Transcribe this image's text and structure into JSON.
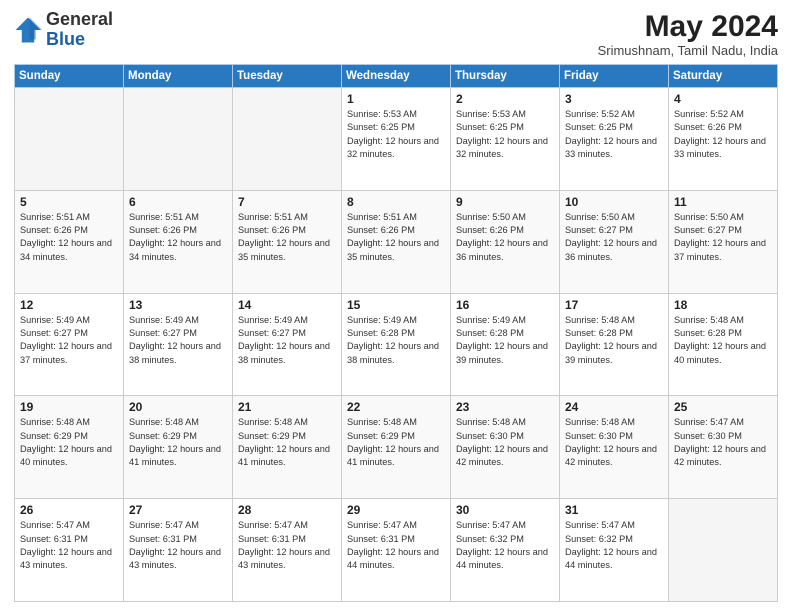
{
  "header": {
    "logo_general": "General",
    "logo_blue": "Blue",
    "month_year": "May 2024",
    "location": "Srimushnam, Tamil Nadu, India"
  },
  "days_of_week": [
    "Sunday",
    "Monday",
    "Tuesday",
    "Wednesday",
    "Thursday",
    "Friday",
    "Saturday"
  ],
  "weeks": [
    [
      {
        "day": "",
        "info": ""
      },
      {
        "day": "",
        "info": ""
      },
      {
        "day": "",
        "info": ""
      },
      {
        "day": "1",
        "info": "Sunrise: 5:53 AM\nSunset: 6:25 PM\nDaylight: 12 hours\nand 32 minutes."
      },
      {
        "day": "2",
        "info": "Sunrise: 5:53 AM\nSunset: 6:25 PM\nDaylight: 12 hours\nand 32 minutes."
      },
      {
        "day": "3",
        "info": "Sunrise: 5:52 AM\nSunset: 6:25 PM\nDaylight: 12 hours\nand 33 minutes."
      },
      {
        "day": "4",
        "info": "Sunrise: 5:52 AM\nSunset: 6:26 PM\nDaylight: 12 hours\nand 33 minutes."
      }
    ],
    [
      {
        "day": "5",
        "info": "Sunrise: 5:51 AM\nSunset: 6:26 PM\nDaylight: 12 hours\nand 34 minutes."
      },
      {
        "day": "6",
        "info": "Sunrise: 5:51 AM\nSunset: 6:26 PM\nDaylight: 12 hours\nand 34 minutes."
      },
      {
        "day": "7",
        "info": "Sunrise: 5:51 AM\nSunset: 6:26 PM\nDaylight: 12 hours\nand 35 minutes."
      },
      {
        "day": "8",
        "info": "Sunrise: 5:51 AM\nSunset: 6:26 PM\nDaylight: 12 hours\nand 35 minutes."
      },
      {
        "day": "9",
        "info": "Sunrise: 5:50 AM\nSunset: 6:26 PM\nDaylight: 12 hours\nand 36 minutes."
      },
      {
        "day": "10",
        "info": "Sunrise: 5:50 AM\nSunset: 6:27 PM\nDaylight: 12 hours\nand 36 minutes."
      },
      {
        "day": "11",
        "info": "Sunrise: 5:50 AM\nSunset: 6:27 PM\nDaylight: 12 hours\nand 37 minutes."
      }
    ],
    [
      {
        "day": "12",
        "info": "Sunrise: 5:49 AM\nSunset: 6:27 PM\nDaylight: 12 hours\nand 37 minutes."
      },
      {
        "day": "13",
        "info": "Sunrise: 5:49 AM\nSunset: 6:27 PM\nDaylight: 12 hours\nand 38 minutes."
      },
      {
        "day": "14",
        "info": "Sunrise: 5:49 AM\nSunset: 6:27 PM\nDaylight: 12 hours\nand 38 minutes."
      },
      {
        "day": "15",
        "info": "Sunrise: 5:49 AM\nSunset: 6:28 PM\nDaylight: 12 hours\nand 38 minutes."
      },
      {
        "day": "16",
        "info": "Sunrise: 5:49 AM\nSunset: 6:28 PM\nDaylight: 12 hours\nand 39 minutes."
      },
      {
        "day": "17",
        "info": "Sunrise: 5:48 AM\nSunset: 6:28 PM\nDaylight: 12 hours\nand 39 minutes."
      },
      {
        "day": "18",
        "info": "Sunrise: 5:48 AM\nSunset: 6:28 PM\nDaylight: 12 hours\nand 40 minutes."
      }
    ],
    [
      {
        "day": "19",
        "info": "Sunrise: 5:48 AM\nSunset: 6:29 PM\nDaylight: 12 hours\nand 40 minutes."
      },
      {
        "day": "20",
        "info": "Sunrise: 5:48 AM\nSunset: 6:29 PM\nDaylight: 12 hours\nand 41 minutes."
      },
      {
        "day": "21",
        "info": "Sunrise: 5:48 AM\nSunset: 6:29 PM\nDaylight: 12 hours\nand 41 minutes."
      },
      {
        "day": "22",
        "info": "Sunrise: 5:48 AM\nSunset: 6:29 PM\nDaylight: 12 hours\nand 41 minutes."
      },
      {
        "day": "23",
        "info": "Sunrise: 5:48 AM\nSunset: 6:30 PM\nDaylight: 12 hours\nand 42 minutes."
      },
      {
        "day": "24",
        "info": "Sunrise: 5:48 AM\nSunset: 6:30 PM\nDaylight: 12 hours\nand 42 minutes."
      },
      {
        "day": "25",
        "info": "Sunrise: 5:47 AM\nSunset: 6:30 PM\nDaylight: 12 hours\nand 42 minutes."
      }
    ],
    [
      {
        "day": "26",
        "info": "Sunrise: 5:47 AM\nSunset: 6:31 PM\nDaylight: 12 hours\nand 43 minutes."
      },
      {
        "day": "27",
        "info": "Sunrise: 5:47 AM\nSunset: 6:31 PM\nDaylight: 12 hours\nand 43 minutes."
      },
      {
        "day": "28",
        "info": "Sunrise: 5:47 AM\nSunset: 6:31 PM\nDaylight: 12 hours\nand 43 minutes."
      },
      {
        "day": "29",
        "info": "Sunrise: 5:47 AM\nSunset: 6:31 PM\nDaylight: 12 hours\nand 44 minutes."
      },
      {
        "day": "30",
        "info": "Sunrise: 5:47 AM\nSunset: 6:32 PM\nDaylight: 12 hours\nand 44 minutes."
      },
      {
        "day": "31",
        "info": "Sunrise: 5:47 AM\nSunset: 6:32 PM\nDaylight: 12 hours\nand 44 minutes."
      },
      {
        "day": "",
        "info": ""
      }
    ]
  ]
}
